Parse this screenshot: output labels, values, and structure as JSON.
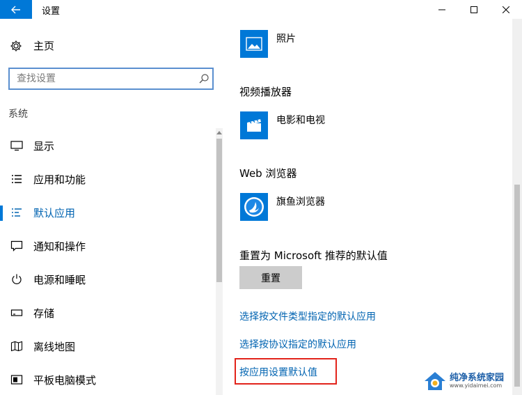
{
  "window": {
    "title": "设置"
  },
  "sidebar": {
    "home_label": "主页",
    "search_placeholder": "查找设置",
    "section_label": "系统",
    "items": [
      {
        "label": "显示",
        "icon": "monitor-icon"
      },
      {
        "label": "应用和功能",
        "icon": "list-icon"
      },
      {
        "label": "默认应用",
        "icon": "default-apps-icon",
        "active": true
      },
      {
        "label": "通知和操作",
        "icon": "notification-icon"
      },
      {
        "label": "电源和睡眠",
        "icon": "power-icon"
      },
      {
        "label": "存储",
        "icon": "storage-icon"
      },
      {
        "label": "离线地图",
        "icon": "map-icon"
      },
      {
        "label": "平板电脑模式",
        "icon": "tablet-icon"
      }
    ]
  },
  "main": {
    "photos_app": "照片",
    "video_heading": "视频播放器",
    "video_app": "电影和电视",
    "web_heading": "Web 浏览器",
    "web_app": "旗鱼浏览器",
    "reset_heading": "重置为 Microsoft 推荐的默认值",
    "reset_button": "重置",
    "links": [
      "选择按文件类型指定的默认应用",
      "选择按协议指定的默认应用",
      "按应用设置默认值"
    ]
  },
  "watermark": {
    "name": "纯净系统家园",
    "url": "www.yidaimei.com"
  },
  "colors": {
    "accent": "#0078d7",
    "link": "#0063b1",
    "highlight": "#e2231a"
  }
}
